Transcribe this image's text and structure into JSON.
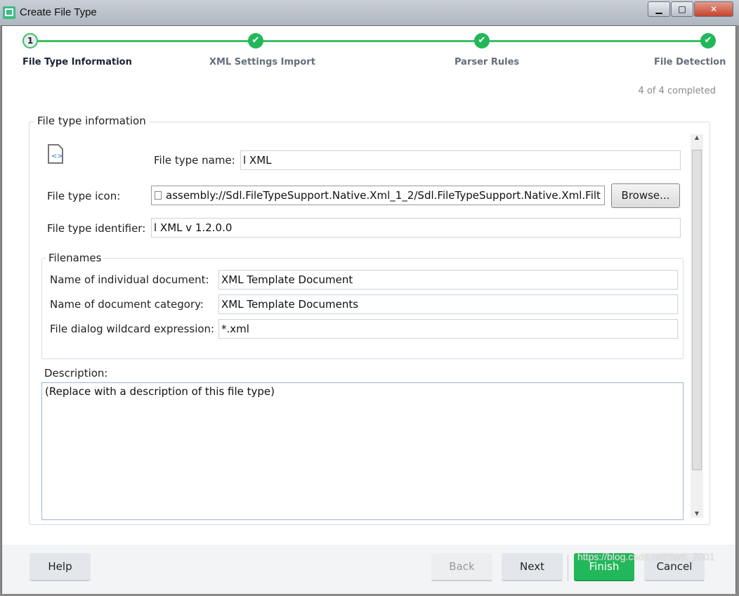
{
  "window": {
    "title": "Create File Type",
    "minimize": "▁",
    "maximize": "□",
    "close": "✕"
  },
  "steps": [
    {
      "label": "File Type Information",
      "number": "1",
      "state": "current"
    },
    {
      "label": "XML Settings Import",
      "state": "done"
    },
    {
      "label": "Parser Rules",
      "state": "done"
    },
    {
      "label": "File Detection",
      "state": "done"
    }
  ],
  "check": "✔",
  "progress": "4 of 4 completed",
  "form": {
    "group_label": "File type information",
    "name_label": "File type name:",
    "name_value": "l XML",
    "icon_label": "File type icon:",
    "icon_value": "assembly://Sdl.FileTypeSupport.Native.Xml_1_2/Sdl.FileTypeSupport.Native.Xml.Filt",
    "browse": "Browse...",
    "id_label": "File type identifier:",
    "id_value": "l XML v 1.2.0.0",
    "filenames_label": "Filenames",
    "doc_label": "Name of individual document:",
    "doc_value": "XML Template Document",
    "cat_label": "Name of document category:",
    "cat_value": "XML Template Documents",
    "wild_label": "File dialog wildcard expression:",
    "wild_value": "*.xml",
    "desc_label": "Description:",
    "desc_value": "(Replace with a description of this file type)"
  },
  "buttons": {
    "help": "Help",
    "back": "Back",
    "next": "Next",
    "finish": "Finish",
    "cancel": "Cancel"
  },
  "colors": {
    "accent": "#22b85a"
  },
  "watermark": "https://blog.csdn.net/dark_2001"
}
